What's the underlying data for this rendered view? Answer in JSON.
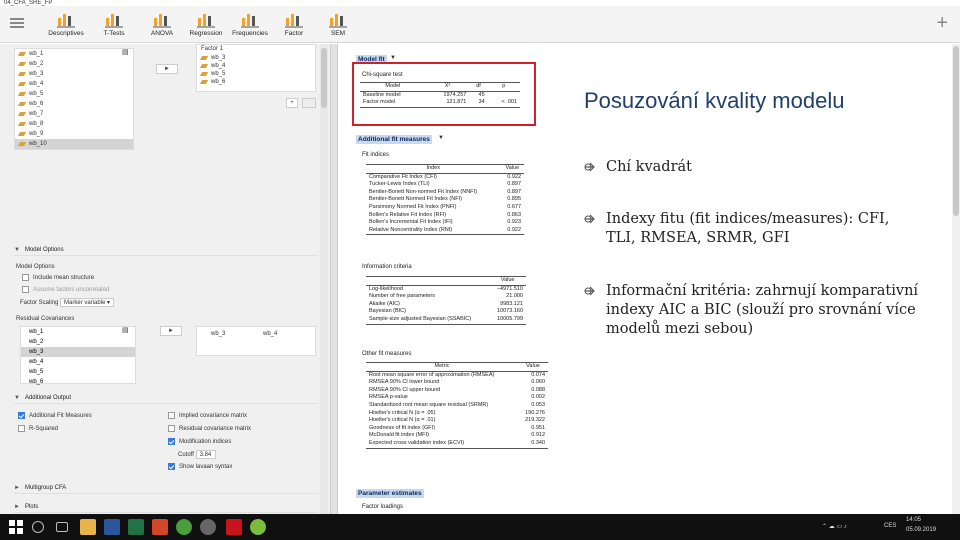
{
  "window": {
    "title": "04_CFA_SRE_FP"
  },
  "toolbar": {
    "items": [
      {
        "label": "Descriptives",
        "icon": "descriptives-icon"
      },
      {
        "label": "T-Tests",
        "icon": "t-tests-icon"
      },
      {
        "label": "ANOVA",
        "icon": "anova-icon"
      },
      {
        "label": "Regression",
        "icon": "regression-icon"
      },
      {
        "label": "Frequencies",
        "icon": "frequencies-icon"
      },
      {
        "label": "Factor",
        "icon": "factor-icon"
      },
      {
        "label": "SEM",
        "icon": "sem-icon"
      }
    ],
    "accent": "#f2a22a"
  },
  "left_panel": {
    "variables": [
      "wb_1",
      "wb_2",
      "wb_3",
      "wb_4",
      "wb_5",
      "wb_6",
      "wb_7",
      "wb_8",
      "wb_9",
      "wb_10"
    ],
    "selected_variable": "wb_10",
    "arrow_label": "►",
    "factor_name": "Factor 1",
    "factor_items": [
      "wb_3",
      "wb_4",
      "wb_5",
      "wb_6"
    ],
    "add_label": "+",
    "model_options_header": "Model Options",
    "model_options_label": "Model Options",
    "include_mean_structure": "Include mean structure",
    "assume_factors_uncorrelated": "Assume factors uncorrelated",
    "factor_scaling_label": "Factor Scaling",
    "factor_scaling_value": "Marker variable",
    "residual_covariances_label": "Residual Covariances",
    "residual_list": [
      "wb_1",
      "wb_2",
      "wb_3",
      "wb_4",
      "wb_5",
      "wb_6"
    ],
    "residual_selected": "wb_3",
    "residual_pair": [
      "wb_3",
      "wb_4"
    ],
    "additional_output_header": "Additional Output",
    "additional_fit_measures": "Additional Fit Measures",
    "r_squared": "R-Squared",
    "implied_cov": "Implied covariance matrix",
    "residual_cov": "Residual covariance matrix",
    "modification_indices": "Modification indices",
    "cutoff_label": "Cutoff",
    "cutoff_value": "3.84",
    "show_lavaan": "Show lavaan syntax",
    "multigroup_header": "Multigroup CFA",
    "plots_header": "Plots"
  },
  "output": {
    "model_fit_header": "Model fit",
    "chi_caption": "Chi-square test",
    "chi_cols": [
      "Model",
      "Χ²",
      "df",
      "p"
    ],
    "chi_rows": [
      [
        "Baseline model",
        "1974.257",
        "45",
        ""
      ],
      [
        "Factor model",
        "121.871",
        "34",
        "< .001"
      ]
    ],
    "afm_header": "Additional fit measures",
    "fit_caption": "Fit indices",
    "fit_cols": [
      "Index",
      "Value"
    ],
    "fit_rows": [
      [
        "Comparative Fit Index (CFI)",
        "0.922"
      ],
      [
        "Tucker-Lewis Index (TLI)",
        "0.897"
      ],
      [
        "Bentler-Bonett Non-normed Fit Index (NNFI)",
        "0.897"
      ],
      [
        "Bentler-Bonett Normed Fit Index (NFI)",
        "0.895"
      ],
      [
        "Parsimony Normed Fit Index (PNFI)",
        "0.677"
      ],
      [
        "Bollen's Relative Fit Index (RFI)",
        "0.863"
      ],
      [
        "Bollen's Incremental Fit Index (IFI)",
        "0.923"
      ],
      [
        "Relative Noncentrality Index (RNI)",
        "0.922"
      ]
    ],
    "info_caption": "Information criteria",
    "info_cols": [
      "",
      "Value"
    ],
    "info_rows": [
      [
        "Log-likelihood",
        "−4971.510"
      ],
      [
        "Number of free parameters",
        "21.000"
      ],
      [
        "Akaike (AIC)",
        "9983.121"
      ],
      [
        "Bayesian (BIC)",
        "10073.160"
      ],
      [
        "Sample-size adjusted Bayesian (SSABIC)",
        "10005.799"
      ]
    ],
    "other_caption": "Other fit measures",
    "other_cols": [
      "Metric",
      "Value"
    ],
    "other_rows": [
      [
        "Root mean square error of approximation (RMSEA)",
        "0.074"
      ],
      [
        "RMSEA 90% CI lower bound",
        "0.060"
      ],
      [
        "RMSEA 90% CI upper bound",
        "0.088"
      ],
      [
        "RMSEA p-value",
        "0.002"
      ],
      [
        "Standardized root mean square residual (SRMR)",
        "0.053"
      ],
      [
        "Hoelter's critical N (α = .05)",
        "190.276"
      ],
      [
        "Hoelter's critical N (α = .01)",
        "219.322"
      ],
      [
        "Goodness of fit index (GFI)",
        "0.951"
      ],
      [
        "McDonald fit index (MFI)",
        "0.912"
      ],
      [
        "Expected cross validation index (ECVI)",
        "0.340"
      ]
    ],
    "param_header": "Parameter estimates",
    "factor_loadings": "Factor loadings"
  },
  "slide": {
    "title": "Posuzování kvality modelu",
    "bullets": [
      "Chí kvadrát",
      "Indexy fitu (fit indices/measures): CFI, TLI, RMSEA, SRMR, GFI",
      "Informační kritéria: zahrnují komparativní indexy AIC a BIC (slouží pro srovnání více modelů mezi sebou)"
    ],
    "title_color": "#20406a"
  },
  "taskbar": {
    "lang": "CES",
    "time": "14:05",
    "date": "05.09.2019"
  }
}
